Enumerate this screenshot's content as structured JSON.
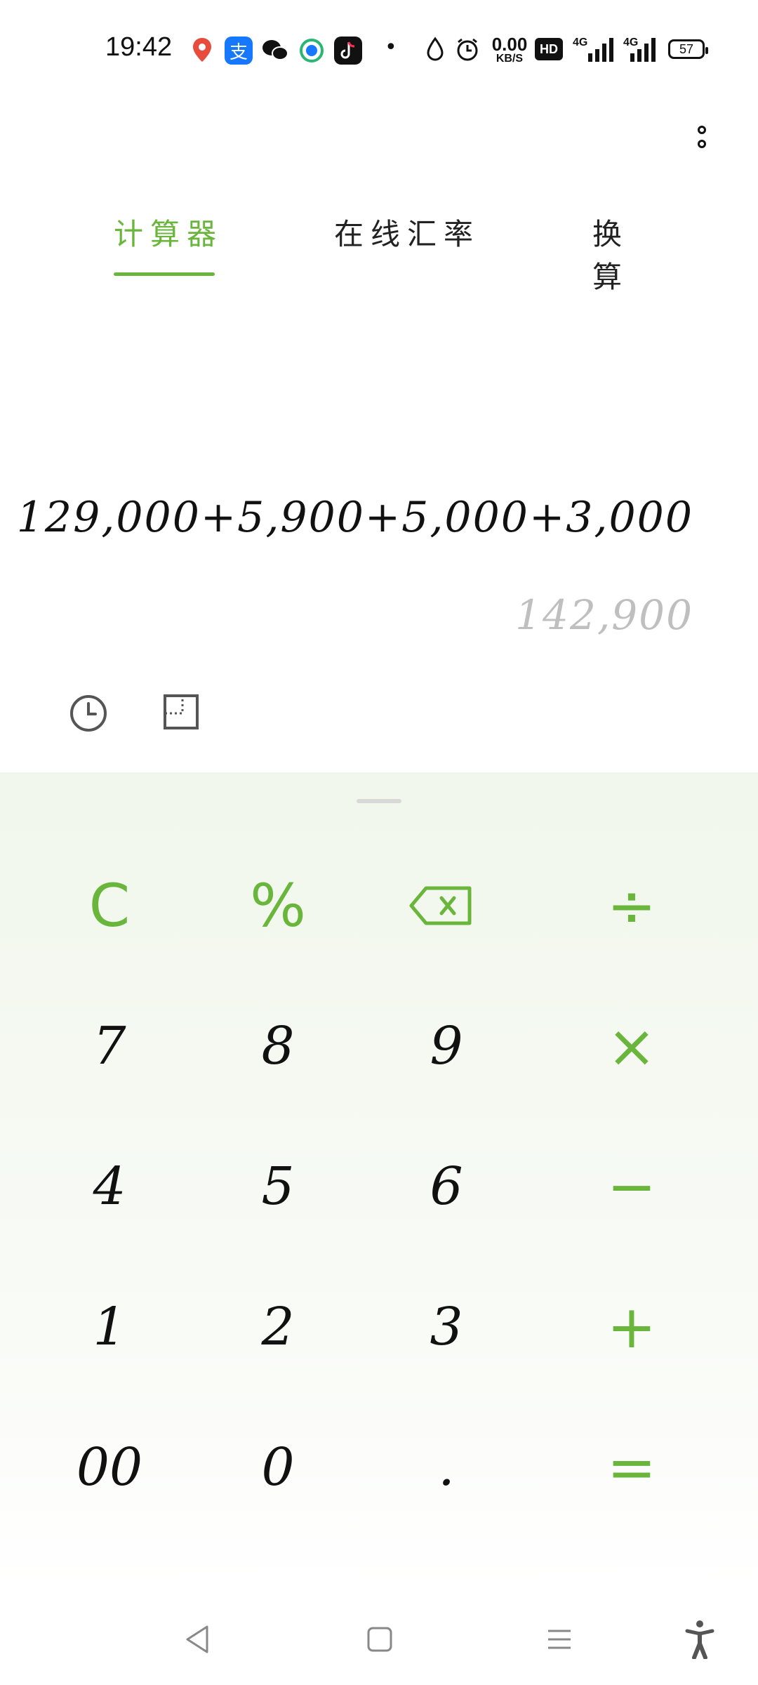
{
  "status_bar": {
    "time": "19:42",
    "net_speed_value": "0.00",
    "net_speed_unit": "KB/S",
    "hd_label": "HD",
    "sim1_label": "4G",
    "sim2_label": "4G",
    "battery": "57",
    "icons": [
      "location-pin-icon",
      "alipay-icon",
      "wechat-icon",
      "bird-icon",
      "tiktok-icon",
      "dot-icon",
      "drop-icon",
      "alarm-icon"
    ]
  },
  "tabs": [
    {
      "label": "计算器",
      "active": true
    },
    {
      "label": "在线汇率",
      "active": false
    },
    {
      "label": "换算",
      "active": false
    }
  ],
  "display": {
    "expression": "129,000+5,900+5,000+3,000",
    "result": "142,900"
  },
  "keypad": {
    "row1": [
      "C",
      "%",
      "⌫",
      "÷"
    ],
    "row2": [
      "7",
      "8",
      "9",
      "×"
    ],
    "row3": [
      "4",
      "5",
      "6",
      "−"
    ],
    "row4": [
      "1",
      "2",
      "3",
      "+"
    ],
    "row5": [
      "00",
      "0",
      ".",
      "="
    ]
  },
  "colors": {
    "accent": "#6ab63c",
    "result_text": "#bfbfbf",
    "pad_bg": "#f1f7ec"
  }
}
